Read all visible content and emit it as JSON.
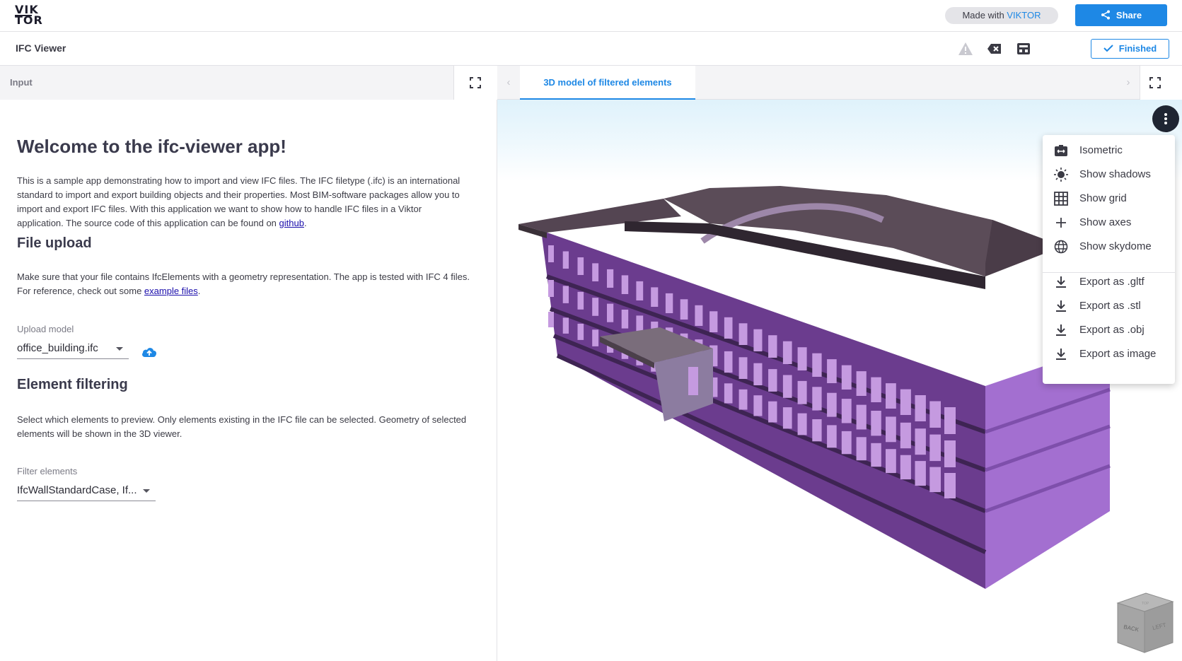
{
  "header": {
    "logo_line1": "VIK",
    "logo_line2": "TOR",
    "made_with_prefix": "Made with ",
    "made_with_brand": "VIKTOR",
    "share_label": "Share"
  },
  "appbar": {
    "title": "IFC Viewer",
    "icons": [
      "warning-icon",
      "clear-icon",
      "archive-icon"
    ],
    "finished_label": "Finished"
  },
  "input_panel": {
    "tab_label": "Input",
    "welcome_title": "Welcome to the ifc-viewer app!",
    "intro_text": "This is a sample app demonstrating how to import and view IFC files. The IFC filetype (.ifc) is an international standard to import and export building objects and their properties. Most BIM-software packages allow you to import and export IFC files. With this application we want to show how to handle IFC files in a Viktor application. The source code of this application can be found on ",
    "intro_link": "github",
    "intro_end": ".",
    "file_upload": {
      "title": "File upload",
      "text": "Make sure that your file contains IfcElements with a geometry representation. The app is tested with IFC 4 files. For reference, check out some ",
      "link": "example files",
      "text_end": ".",
      "field_label": "Upload model",
      "field_value": "office_building.ifc"
    },
    "element_filtering": {
      "title": "Element filtering",
      "text": "Select which elements to preview. Only elements existing in the IFC file can be selected. Geometry of selected elements will be shown in the 3D viewer.",
      "field_label": "Filter elements",
      "field_value": "IfcWallStandardCase, If..."
    }
  },
  "viewer": {
    "tab_prev": "‹",
    "tab_label": "3D model of filtered elements",
    "tab_next": "›",
    "menu": {
      "items": [
        {
          "label": "Isometric",
          "icon": "isometric-icon"
        },
        {
          "label": "Show shadows",
          "icon": "sun-icon"
        },
        {
          "label": "Show grid",
          "icon": "grid-icon"
        },
        {
          "label": "Show axes",
          "icon": "plus-icon"
        },
        {
          "label": "Show skydome",
          "icon": "globe-icon"
        },
        {
          "label": "Export as .gltf",
          "icon": "download-icon"
        },
        {
          "label": "Export as .stl",
          "icon": "download-icon"
        },
        {
          "label": "Export as .obj",
          "icon": "download-icon"
        },
        {
          "label": "Export as image",
          "icon": "download-icon"
        }
      ]
    },
    "navcube": {
      "face_back": "BACK",
      "face_left": "LEFT",
      "face_top": "TOP"
    },
    "colors": {
      "accent": "#1e88e5",
      "building_wall": "#6b3c8e",
      "building_roof": "#544552",
      "window": "#c59ae0"
    }
  }
}
